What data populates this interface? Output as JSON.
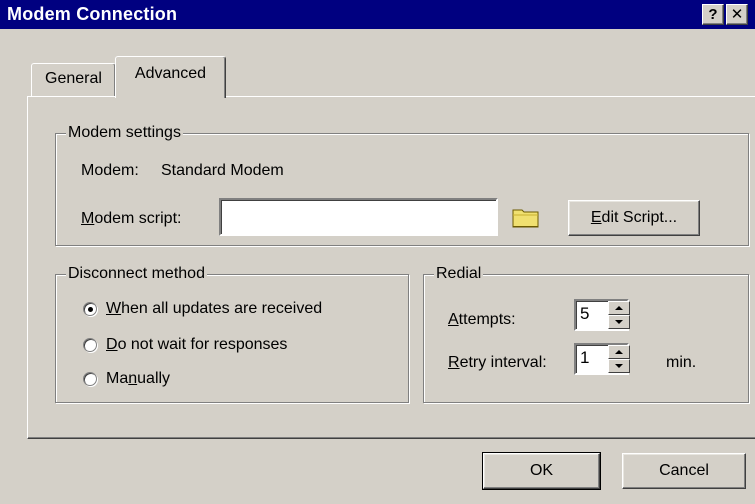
{
  "window": {
    "title": "Modem Connection",
    "help_button": "?",
    "close_button": "✕"
  },
  "tabs": [
    {
      "label": "General"
    },
    {
      "label": "Advanced"
    }
  ],
  "modem_settings": {
    "legend": "Modem settings",
    "modem_label": "Modem:",
    "modem_value": "Standard Modem",
    "script_label_u": "M",
    "script_label_rest": "odem script:",
    "script_value": "",
    "edit_script_u": "E",
    "edit_script_rest": "dit Script..."
  },
  "disconnect_method": {
    "legend": "Disconnect method",
    "options": [
      {
        "u": "W",
        "rest": "hen all updates are received",
        "checked": true
      },
      {
        "u": "D",
        "rest": "o not wait for responses",
        "checked": false
      },
      {
        "pre": "Ma",
        "u": "n",
        "rest": "ually",
        "checked": false
      }
    ]
  },
  "redial": {
    "legend": "Redial",
    "attempts_u": "A",
    "attempts_rest": "ttempts:",
    "attempts_value": "5",
    "retry_u": "R",
    "retry_rest": "etry interval:",
    "retry_value": "1",
    "retry_unit": "min."
  },
  "footer": {
    "ok_label": "OK",
    "cancel_label": "Cancel"
  }
}
